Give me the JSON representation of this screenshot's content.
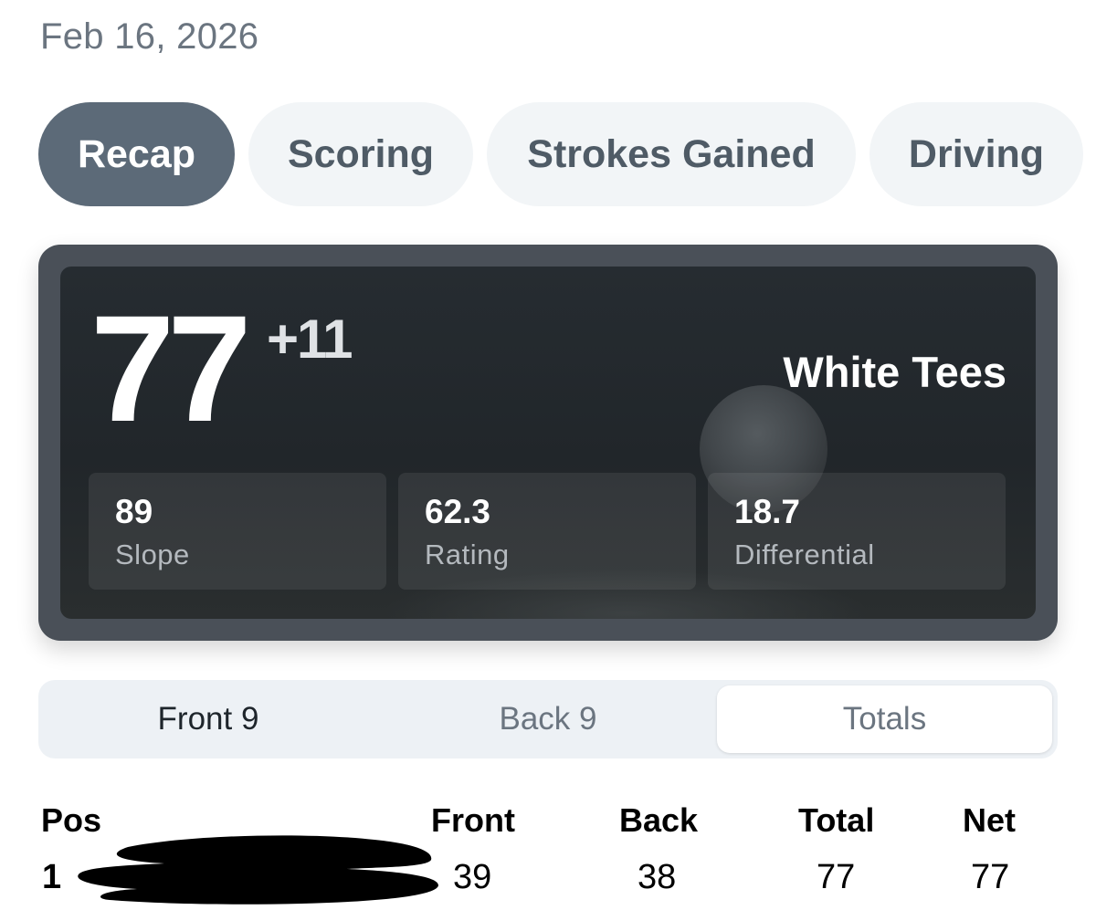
{
  "date": "Feb 16, 2026",
  "tabs": [
    {
      "label": "Recap",
      "active": true
    },
    {
      "label": "Scoring",
      "active": false
    },
    {
      "label": "Strokes Gained",
      "active": false
    },
    {
      "label": "Driving",
      "active": false
    }
  ],
  "score_card": {
    "score": "77",
    "over_par": "+11",
    "tees": "White Tees",
    "stats": [
      {
        "value": "89",
        "label": "Slope"
      },
      {
        "value": "62.3",
        "label": "Rating"
      },
      {
        "value": "18.7",
        "label": "Differential"
      }
    ]
  },
  "segments": {
    "front": "Front 9",
    "back": "Back 9",
    "totals": "Totals",
    "selected": "Totals"
  },
  "table": {
    "headers": {
      "pos": "Pos",
      "front": "Front",
      "back": "Back",
      "total": "Total",
      "net": "Net"
    },
    "rows": [
      {
        "pos": "1",
        "front": "39",
        "back": "38",
        "total": "77",
        "net": "77"
      }
    ]
  },
  "colors": {
    "tab_active_bg": "#5c6a78",
    "tab_bg": "#f2f5f7",
    "card_bg": "#4a5058",
    "segment_bg": "#edf1f5"
  }
}
